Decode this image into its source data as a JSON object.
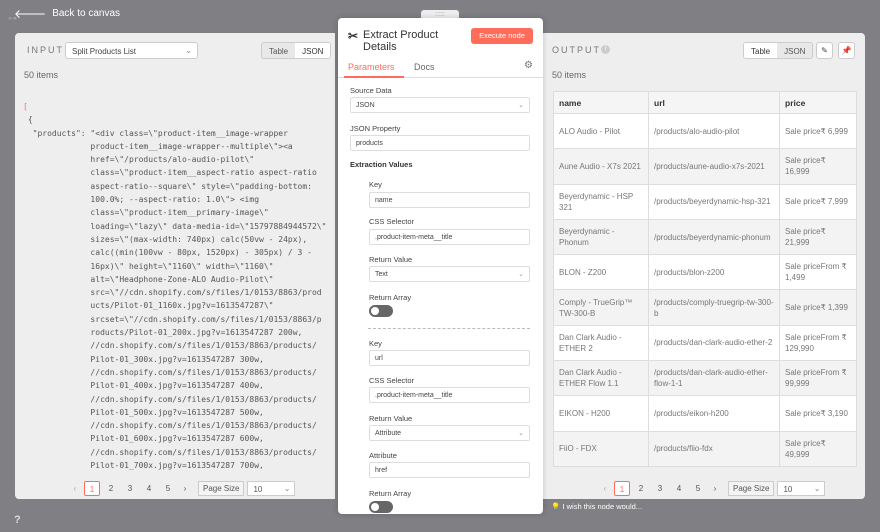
{
  "nav": {
    "back_label": "Back to canvas",
    "help": "?"
  },
  "input_panel": {
    "label": "INPUT",
    "source_select": "Split Products List",
    "toggle": [
      "Table",
      "JSON"
    ],
    "count": "50 items",
    "json_lines": [
      "[",
      " {",
      "  \"products\": \"<div class=\\\"product-item__image-wrapper",
      "              product-item__image-wrapper--multiple\\\"><a",
      "              href=\\\"/products/alo-audio-pilot\\\"",
      "              class=\\\"product-item__aspect-ratio aspect-ratio",
      "              aspect-ratio--square\\\" style=\\\"padding-bottom:",
      "              100.0%; --aspect-ratio: 1.0\\\"> <img",
      "              class=\\\"product-item__primary-image\\\"",
      "              loading=\\\"lazy\\\" data-media-id=\\\"15797884944572\\\"",
      "              sizes=\\\"(max-width: 740px) calc(50vw - 24px),",
      "              calc((min(100vw - 80px, 1520px) - 305px) / 3 -",
      "              16px)\\\" height=\\\"1160\\\" width=\\\"1160\\\"",
      "              alt=\\\"Headphone-Zone-ALO Audio-Pilot\\\"",
      "              src=\\\"//cdn.shopify.com/s/files/1/0153/8863/prod",
      "              ucts/Pilot-01_1160x.jpg?v=1613547287\\\"",
      "              srcset=\\\"//cdn.shopify.com/s/files/1/0153/8863/p",
      "              roducts/Pilot-01_200x.jpg?v=1613547287 200w,",
      "              //cdn.shopify.com/s/files/1/0153/8863/products/",
      "              Pilot-01_300x.jpg?v=1613547287 300w,",
      "              //cdn.shopify.com/s/files/1/0153/8863/products/",
      "              Pilot-01_400x.jpg?v=1613547287 400w,",
      "              //cdn.shopify.com/s/files/1/0153/8863/products/",
      "              Pilot-01_500x.jpg?v=1613547287 500w,",
      "              //cdn.shopify.com/s/files/1/0153/8863/products/",
      "              Pilot-01_600x.jpg?v=1613547287 600w,",
      "              //cdn.shopify.com/s/files/1/0153/8863/products/",
      "              Pilot-01_700x.jpg?v=1613547287 700w,"
    ]
  },
  "pagination": {
    "pages": [
      "1",
      "2",
      "3",
      "4",
      "5"
    ],
    "prev": "‹",
    "next": "›",
    "page_size_label": "Page Size",
    "page_size_value": "10"
  },
  "node": {
    "title": "Extract Product Details",
    "execute_label": "Execute node",
    "tabs": [
      "Parameters",
      "Docs"
    ],
    "source_data_label": "Source Data",
    "source_data_value": "JSON",
    "json_property_label": "JSON Property",
    "json_property_value": "products",
    "extraction_values_label": "Extraction Values",
    "key_label": "Key",
    "css_selector_label": "CSS Selector",
    "return_value_label": "Return Value",
    "return_array_label": "Return Array",
    "attribute_label": "Attribute",
    "values": [
      {
        "key": "name",
        "css_selector": ".product-item-meta__title",
        "return_value": "Text"
      },
      {
        "key": "url",
        "css_selector": ".product-item-meta__title",
        "return_value": "Attribute",
        "attribute": "href"
      }
    ]
  },
  "output_panel": {
    "label": "OUTPUT",
    "info": "i",
    "toggle": [
      "Table",
      "JSON"
    ],
    "count": "50 items",
    "columns": [
      "name",
      "url",
      "price"
    ],
    "rows": [
      [
        "ALO Audio - Pilot",
        "/products/alo-audio-pilot",
        "Sale price₹ 6,999"
      ],
      [
        "Aune Audio - X7s 2021",
        "/products/aune-audio-x7s-2021",
        "Sale price₹ 16,999"
      ],
      [
        "Beyerdynamic - HSP 321",
        "/products/beyerdynamic-hsp-321",
        "Sale price₹ 7,999"
      ],
      [
        "Beyerdynamic - Phonum",
        "/products/beyerdynamic-phonum",
        "Sale price₹ 21,999"
      ],
      [
        "BLON - Z200",
        "/products/blon-z200",
        "Sale priceFrom ₹ 1,499"
      ],
      [
        "Comply - TrueGrip™ TW-300-B",
        "/products/comply-truegrip-tw-300-b",
        "Sale price₹ 1,399"
      ],
      [
        "Dan Clark Audio - ETHER 2",
        "/products/dan-clark-audio-ether-2",
        "Sale priceFrom ₹ 129,990"
      ],
      [
        "Dan Clark Audio - ETHER Flow 1.1",
        "/products/dan-clark-audio-ether-flow-1-1",
        "Sale priceFrom ₹ 99,999"
      ],
      [
        "EIKON - H200",
        "/products/eikon-h200",
        "Sale price₹ 3,190"
      ],
      [
        "FiiO - FDX",
        "/products/fiio-fdx",
        "Sale price₹ 49,999"
      ]
    ]
  },
  "hint": "I wish this node would..."
}
